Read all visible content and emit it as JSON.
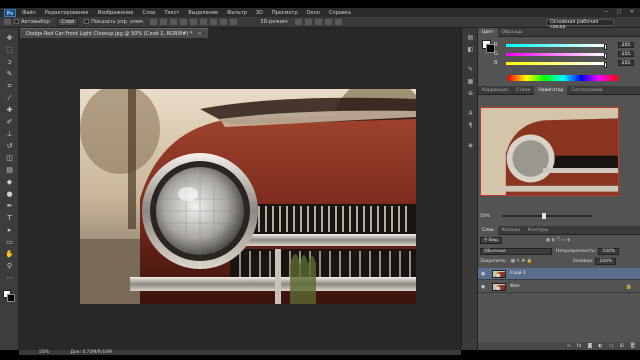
{
  "app": {
    "logo": "Ps"
  },
  "menubar": {
    "items": [
      "Файл",
      "Редактирование",
      "Изображение",
      "Слои",
      "Текст",
      "Выделение",
      "Фильтр",
      "3D",
      "Просмотр",
      "Окно",
      "Справка"
    ]
  },
  "window_controls": [
    "—",
    "□",
    "✕"
  ],
  "options_bar": {
    "autoselect_label": "Автовыбор:",
    "autoselect_value": "Слой",
    "show_transform_label": "Показать упр. элем.",
    "mode_3d_label": "3D-режим:",
    "workspace": "Основная рабочая среда"
  },
  "document": {
    "tab_title": "Dodge Red Car Front Light Closeup.jpg @ 50% (Слой 1, RGB/8#) *",
    "tab_close": "×"
  },
  "statusbar": {
    "zoom": "50%",
    "doc_info": "Док: 4,73М/9,63М"
  },
  "tools": [
    {
      "name": "move-tool-icon",
      "glyph": "✥"
    },
    {
      "name": "marquee-tool-icon",
      "glyph": "⬚"
    },
    {
      "name": "lasso-tool-icon",
      "glyph": "ↄ"
    },
    {
      "name": "quick-select-tool-icon",
      "glyph": "✎"
    },
    {
      "name": "crop-tool-icon",
      "glyph": "⌗"
    },
    {
      "name": "eyedropper-tool-icon",
      "glyph": "⁄"
    },
    {
      "name": "healing-tool-icon",
      "glyph": "✚"
    },
    {
      "name": "brush-tool-icon",
      "glyph": "✐"
    },
    {
      "name": "stamp-tool-icon",
      "glyph": "⊥"
    },
    {
      "name": "history-brush-tool-icon",
      "glyph": "↺"
    },
    {
      "name": "eraser-tool-icon",
      "glyph": "◫"
    },
    {
      "name": "gradient-tool-icon",
      "glyph": "▤"
    },
    {
      "name": "blur-tool-icon",
      "glyph": "◆"
    },
    {
      "name": "dodge-tool-icon",
      "glyph": "●"
    },
    {
      "name": "pen-tool-icon",
      "glyph": "✒"
    },
    {
      "name": "type-tool-icon",
      "glyph": "T"
    },
    {
      "name": "path-select-tool-icon",
      "glyph": "▸"
    },
    {
      "name": "shape-tool-icon",
      "glyph": "▭"
    },
    {
      "name": "hand-tool-icon",
      "glyph": "✋"
    },
    {
      "name": "zoom-tool-icon",
      "glyph": "⚲"
    },
    {
      "name": "extras-icon",
      "glyph": "⋯"
    }
  ],
  "color_panel": {
    "tabs": [
      "Цвет",
      "Образцы"
    ],
    "channels": [
      {
        "label": "R",
        "value": "255",
        "level": 1.0,
        "track": "linear-gradient(90deg,#00ffff,#ffffff)"
      },
      {
        "label": "G",
        "value": "255",
        "level": 1.0,
        "track": "linear-gradient(90deg,#ff00ff,#ffffff)"
      },
      {
        "label": "B",
        "value": "255",
        "level": 1.0,
        "track": "linear-gradient(90deg,#ffff00,#ffffff)"
      }
    ]
  },
  "navigator_panel": {
    "tabs": [
      "Коррекция",
      "Стили",
      "Навигатор",
      "Гистограмма"
    ],
    "active_tab": 2,
    "zoom": "50%"
  },
  "layers_panel": {
    "tabs": [
      "Слои",
      "Каналы",
      "Контуры"
    ],
    "filter_kind": "Вид",
    "blend_mode": "Обычные",
    "opacity_label": "Непрозрачность:",
    "opacity_value": "100%",
    "lock_label": "Закрепить:",
    "fill_label": "Заливка:",
    "fill_value": "100%",
    "layers": [
      {
        "name": "Слой 1",
        "selected": true,
        "locked": false
      },
      {
        "name": "Фон",
        "selected": false,
        "locked": true
      }
    ]
  },
  "colors": {
    "accent_selected": "#5a6f8f",
    "car_red": "#7a2a1c"
  }
}
